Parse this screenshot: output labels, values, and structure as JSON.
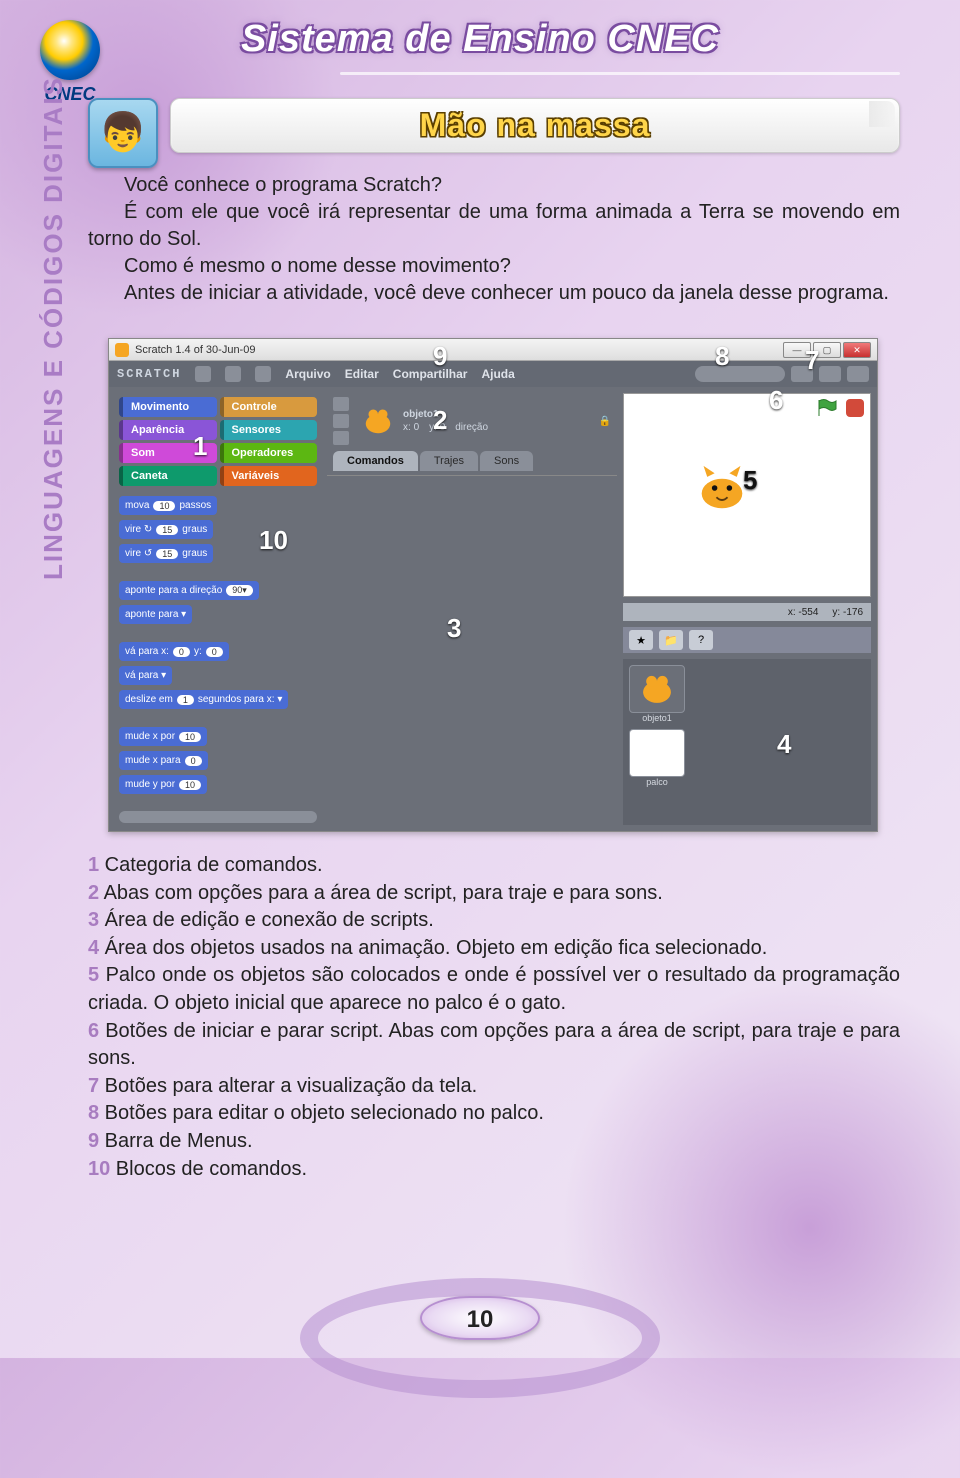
{
  "brand": {
    "logo_label": "CNEC"
  },
  "header": {
    "title": "Sistema de Ensino CNEC"
  },
  "section": {
    "banner": "Mão na massa",
    "icon_glyph": "👦"
  },
  "side_label": "LINGUAGENS E CÓDIGOS DIGITAIS",
  "intro": {
    "p1": "Você conhece o programa Scratch?",
    "p2": "É com ele que você irá representar de uma forma animada a Terra se movendo em torno do Sol.",
    "p3": "Como é mesmo o nome desse movimento?",
    "p4": "Antes de iniciar a atividade, você deve conhecer um pouco da janela desse programa."
  },
  "screenshot": {
    "window_title": "Scratch 1.4 of 30-Jun-09",
    "app_logo": "SCRATCH",
    "menubar": {
      "items": [
        "Arquivo",
        "Editar",
        "Compartilhar",
        "Ajuda"
      ]
    },
    "categories": [
      {
        "label": "Movimento",
        "cls": "blue"
      },
      {
        "label": "Controle",
        "cls": "orange"
      },
      {
        "label": "Aparência",
        "cls": "purple"
      },
      {
        "label": "Sensores",
        "cls": "teal"
      },
      {
        "label": "Som",
        "cls": "pink"
      },
      {
        "label": "Operadores",
        "cls": "green"
      },
      {
        "label": "Caneta",
        "cls": "dkgreen"
      },
      {
        "label": "Variáveis",
        "cls": "dorange"
      }
    ],
    "blocks": [
      {
        "pre": "mova",
        "pill": "10",
        "post": "passos"
      },
      {
        "pre": "vire ↻",
        "pill": "15",
        "post": "graus"
      },
      {
        "pre": "vire ↺",
        "pill": "15",
        "post": "graus"
      },
      {
        "pre": "aponte para a direção",
        "pill": "90▾",
        "post": ""
      },
      {
        "pre": "aponte para ▾",
        "pill": "",
        "post": ""
      },
      {
        "pre": "vá para x:",
        "pill": "0",
        "mid": "y:",
        "pill2": "0",
        "post": ""
      },
      {
        "pre": "vá para ▾",
        "pill": "",
        "post": ""
      },
      {
        "pre": "deslize em",
        "pill": "1",
        "post": "segundos para x: ▾"
      },
      {
        "pre": "mude x por",
        "pill": "10",
        "post": ""
      },
      {
        "pre": "mude x para",
        "pill": "0",
        "post": ""
      },
      {
        "pre": "mude y por",
        "pill": "10",
        "post": ""
      }
    ],
    "sprite_info": {
      "name": "objeto1",
      "x_label": "x:",
      "x_val": "0",
      "y_label": "y:",
      "y_val": "0",
      "dir_label": "direção"
    },
    "tabs": {
      "comandos": "Comandos",
      "trajes": "Trajes",
      "sons": "Sons"
    },
    "stage": {
      "coords_x_label": "x:",
      "coords_x": "-554",
      "coords_y_label": "y:",
      "coords_y": "-176"
    },
    "sprites": {
      "objeto1": "objeto1",
      "palco": "palco"
    },
    "toolbar_icons": [
      "★",
      "📁",
      "?"
    ],
    "annotations": {
      "a1": "1",
      "a2": "2",
      "a3": "3",
      "a4": "4",
      "a5": "5",
      "a6": "6",
      "a7": "7",
      "a8": "8",
      "a9": "9",
      "a10": "10"
    }
  },
  "legend": {
    "1": {
      "n": "1",
      "t": " Categoria de comandos."
    },
    "2": {
      "n": "2",
      "t": " Abas com opções para a área de script, para traje e para sons."
    },
    "3": {
      "n": "3",
      "t": " Área de edição e conexão de scripts."
    },
    "4": {
      "n": "4",
      "t": " Área dos objetos usados na animação. Objeto em edição fica selecionado."
    },
    "5": {
      "n": "5",
      "t": " Palco onde os objetos são colocados e onde é possível ver o resultado da programação criada. O objeto inicial que aparece no palco é o gato."
    },
    "6": {
      "n": "6",
      "t": " Botões de iniciar e parar script. Abas com opções para a área de script, para traje e para sons."
    },
    "7": {
      "n": "7",
      "t": " Botões para alterar a visualização da tela."
    },
    "8": {
      "n": "8",
      "t": " Botões para editar o objeto selecionado no palco."
    },
    "9": {
      "n": "9",
      "t": " Barra de Menus."
    },
    "10": {
      "n": "10",
      "t": " Blocos de comandos."
    }
  },
  "page_number": "10"
}
